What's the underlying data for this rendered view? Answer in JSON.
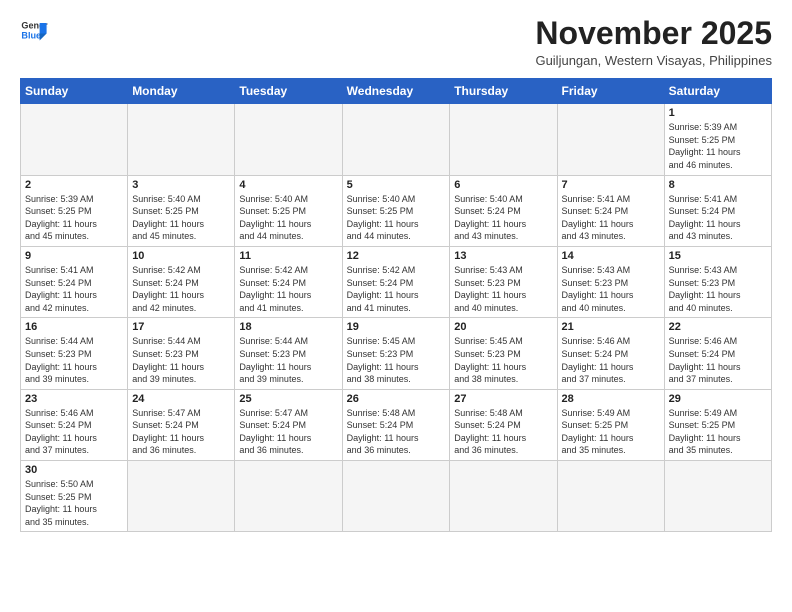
{
  "header": {
    "logo_general": "General",
    "logo_blue": "Blue",
    "month_title": "November 2025",
    "subtitle": "Guiljungan, Western Visayas, Philippines"
  },
  "days_of_week": [
    "Sunday",
    "Monday",
    "Tuesday",
    "Wednesday",
    "Thursday",
    "Friday",
    "Saturday"
  ],
  "weeks": [
    [
      {
        "day": "",
        "info": ""
      },
      {
        "day": "",
        "info": ""
      },
      {
        "day": "",
        "info": ""
      },
      {
        "day": "",
        "info": ""
      },
      {
        "day": "",
        "info": ""
      },
      {
        "day": "",
        "info": ""
      },
      {
        "day": "1",
        "info": "Sunrise: 5:39 AM\nSunset: 5:25 PM\nDaylight: 11 hours\nand 46 minutes."
      }
    ],
    [
      {
        "day": "2",
        "info": "Sunrise: 5:39 AM\nSunset: 5:25 PM\nDaylight: 11 hours\nand 45 minutes."
      },
      {
        "day": "3",
        "info": "Sunrise: 5:40 AM\nSunset: 5:25 PM\nDaylight: 11 hours\nand 45 minutes."
      },
      {
        "day": "4",
        "info": "Sunrise: 5:40 AM\nSunset: 5:25 PM\nDaylight: 11 hours\nand 44 minutes."
      },
      {
        "day": "5",
        "info": "Sunrise: 5:40 AM\nSunset: 5:25 PM\nDaylight: 11 hours\nand 44 minutes."
      },
      {
        "day": "6",
        "info": "Sunrise: 5:40 AM\nSunset: 5:24 PM\nDaylight: 11 hours\nand 43 minutes."
      },
      {
        "day": "7",
        "info": "Sunrise: 5:41 AM\nSunset: 5:24 PM\nDaylight: 11 hours\nand 43 minutes."
      },
      {
        "day": "8",
        "info": "Sunrise: 5:41 AM\nSunset: 5:24 PM\nDaylight: 11 hours\nand 43 minutes."
      }
    ],
    [
      {
        "day": "9",
        "info": "Sunrise: 5:41 AM\nSunset: 5:24 PM\nDaylight: 11 hours\nand 42 minutes."
      },
      {
        "day": "10",
        "info": "Sunrise: 5:42 AM\nSunset: 5:24 PM\nDaylight: 11 hours\nand 42 minutes."
      },
      {
        "day": "11",
        "info": "Sunrise: 5:42 AM\nSunset: 5:24 PM\nDaylight: 11 hours\nand 41 minutes."
      },
      {
        "day": "12",
        "info": "Sunrise: 5:42 AM\nSunset: 5:24 PM\nDaylight: 11 hours\nand 41 minutes."
      },
      {
        "day": "13",
        "info": "Sunrise: 5:43 AM\nSunset: 5:23 PM\nDaylight: 11 hours\nand 40 minutes."
      },
      {
        "day": "14",
        "info": "Sunrise: 5:43 AM\nSunset: 5:23 PM\nDaylight: 11 hours\nand 40 minutes."
      },
      {
        "day": "15",
        "info": "Sunrise: 5:43 AM\nSunset: 5:23 PM\nDaylight: 11 hours\nand 40 minutes."
      }
    ],
    [
      {
        "day": "16",
        "info": "Sunrise: 5:44 AM\nSunset: 5:23 PM\nDaylight: 11 hours\nand 39 minutes."
      },
      {
        "day": "17",
        "info": "Sunrise: 5:44 AM\nSunset: 5:23 PM\nDaylight: 11 hours\nand 39 minutes."
      },
      {
        "day": "18",
        "info": "Sunrise: 5:44 AM\nSunset: 5:23 PM\nDaylight: 11 hours\nand 39 minutes."
      },
      {
        "day": "19",
        "info": "Sunrise: 5:45 AM\nSunset: 5:23 PM\nDaylight: 11 hours\nand 38 minutes."
      },
      {
        "day": "20",
        "info": "Sunrise: 5:45 AM\nSunset: 5:23 PM\nDaylight: 11 hours\nand 38 minutes."
      },
      {
        "day": "21",
        "info": "Sunrise: 5:46 AM\nSunset: 5:24 PM\nDaylight: 11 hours\nand 37 minutes."
      },
      {
        "day": "22",
        "info": "Sunrise: 5:46 AM\nSunset: 5:24 PM\nDaylight: 11 hours\nand 37 minutes."
      }
    ],
    [
      {
        "day": "23",
        "info": "Sunrise: 5:46 AM\nSunset: 5:24 PM\nDaylight: 11 hours\nand 37 minutes."
      },
      {
        "day": "24",
        "info": "Sunrise: 5:47 AM\nSunset: 5:24 PM\nDaylight: 11 hours\nand 36 minutes."
      },
      {
        "day": "25",
        "info": "Sunrise: 5:47 AM\nSunset: 5:24 PM\nDaylight: 11 hours\nand 36 minutes."
      },
      {
        "day": "26",
        "info": "Sunrise: 5:48 AM\nSunset: 5:24 PM\nDaylight: 11 hours\nand 36 minutes."
      },
      {
        "day": "27",
        "info": "Sunrise: 5:48 AM\nSunset: 5:24 PM\nDaylight: 11 hours\nand 36 minutes."
      },
      {
        "day": "28",
        "info": "Sunrise: 5:49 AM\nSunset: 5:25 PM\nDaylight: 11 hours\nand 35 minutes."
      },
      {
        "day": "29",
        "info": "Sunrise: 5:49 AM\nSunset: 5:25 PM\nDaylight: 11 hours\nand 35 minutes."
      }
    ],
    [
      {
        "day": "30",
        "info": "Sunrise: 5:50 AM\nSunset: 5:25 PM\nDaylight: 11 hours\nand 35 minutes."
      },
      {
        "day": "",
        "info": ""
      },
      {
        "day": "",
        "info": ""
      },
      {
        "day": "",
        "info": ""
      },
      {
        "day": "",
        "info": ""
      },
      {
        "day": "",
        "info": ""
      },
      {
        "day": "",
        "info": ""
      }
    ]
  ]
}
